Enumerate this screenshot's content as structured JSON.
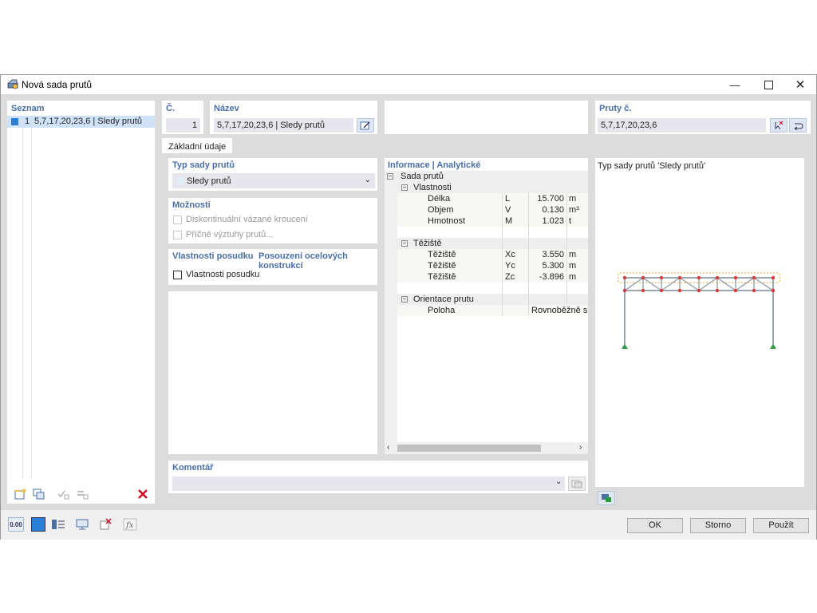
{
  "window": {
    "title": "Nová sada prutů"
  },
  "list": {
    "header": "Seznam",
    "items": [
      {
        "no": "1",
        "label": "5,7,17,20,23,6 | Sledy prutů",
        "color": "#2a7fd4"
      }
    ]
  },
  "number": {
    "label": "Č.",
    "value": "1"
  },
  "name": {
    "label": "Název",
    "value": "5,7,17,20,23,6 | Sledy prutů"
  },
  "members": {
    "label": "Pruty č.",
    "value": "5,7,17,20,23,6"
  },
  "tabs": [
    "Základní údaje"
  ],
  "type": {
    "header": "Typ sady prutů",
    "value": "Sledy prutů"
  },
  "options": {
    "header": "Možnosti",
    "items": [
      "Diskontinuální vázané kroucení",
      "Příčné výztuhy prutů..."
    ]
  },
  "design": {
    "tab_properties": "Vlastnosti posudku",
    "tab_steel": "Posouzení ocelových konstrukcí",
    "checkbox_label": "Vlastnosti posudku"
  },
  "info": {
    "header": "Informace | Analytické",
    "root": "Sada prutů",
    "properties_group": "Vlastnosti",
    "properties": [
      {
        "name": "Délka",
        "sym": "L",
        "value": "15.700",
        "unit": "m"
      },
      {
        "name": "Objem",
        "sym": "V",
        "value": "0.130",
        "unit": "m³"
      },
      {
        "name": "Hmotnost",
        "sym": "M",
        "value": "1.023",
        "unit": "t"
      }
    ],
    "centroid_group": "Těžiště",
    "centroid": [
      {
        "name": "Těžiště",
        "sym": "Xc",
        "value": "3.550",
        "unit": "m"
      },
      {
        "name": "Těžiště",
        "sym": "Yc",
        "value": "5.300",
        "unit": "m"
      },
      {
        "name": "Těžiště",
        "sym": "Zc",
        "value": "-3.896",
        "unit": "m"
      }
    ],
    "orientation_group": "Orientace prutu",
    "orientation": [
      {
        "name": "Poloha",
        "value": "Rovnoběžně s r"
      }
    ]
  },
  "preview": {
    "title": "Typ sady prutů 'Sledy prutů'"
  },
  "comment": {
    "header": "Komentář",
    "value": ""
  },
  "buttons": {
    "ok": "OK",
    "cancel": "Storno",
    "apply": "Použít"
  },
  "toolbar": {
    "units_label": "0.00"
  },
  "colors": {
    "accent": "#2a7fd4",
    "header": "#4a6fa5",
    "delete": "#d0021b",
    "support": "#2a9d3a",
    "node": "#d83a3a",
    "highlight": "#f0a030"
  }
}
